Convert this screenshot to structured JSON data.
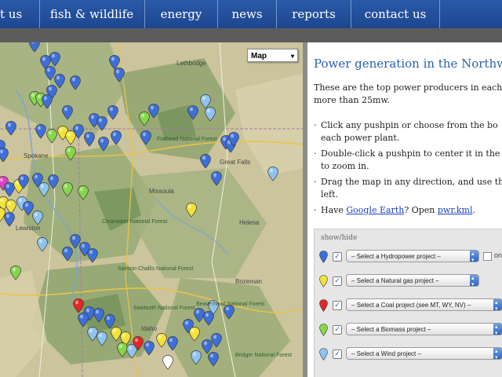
{
  "nav": {
    "items": [
      {
        "label": "t us"
      },
      {
        "label": "fish & wildlife"
      },
      {
        "label": "energy"
      },
      {
        "label": "news"
      },
      {
        "label": "reports"
      },
      {
        "label": "contact us"
      }
    ]
  },
  "map": {
    "type_control": "Map",
    "places": [
      "Lethbridge",
      "Spokane",
      "Great Falls",
      "Missoula",
      "Lewiston",
      "Idaho",
      "Helena",
      "Bozeman"
    ],
    "forests": [
      "Flathead National Forest",
      "Clearwater National Forest",
      "Salmon-Challis National Forest",
      "Sawtooth National Forest",
      "Beaverhead National Forest",
      "Bridger National Forest"
    ],
    "pin_colors": {
      "hydro": "#3d6fd8",
      "light_blue": "#8ec4ee",
      "natural_gas": "#f2e23a",
      "coal": "#e02828",
      "biomass": "#86d64a",
      "pink": "#e040c0",
      "white": "#ffffff"
    }
  },
  "panel": {
    "title": "Power generation in the Northw",
    "intro_line1": "These are the top power producers in each",
    "intro_line2": "more than 25mw.",
    "bullets": [
      {
        "line1": "Click any pushpin or choose from the bo",
        "line2": "each power plant."
      },
      {
        "line1": "Double-click a pushpin to center it in the",
        "line2": "to zoom in."
      },
      {
        "line1": "Drag the map in any direction, and use th",
        "line2": "left."
      }
    ],
    "have_prefix": "Have",
    "google_earth": "Google Earth",
    "open_text": "? Open",
    "kml_link": "pwr.kml",
    "kml_suffix": "."
  },
  "controls": {
    "showhide": "show/hide",
    "rows": [
      {
        "pin_color": "#3d6fd8",
        "label": "– Select a Hydropower project –",
        "extra": "onl"
      },
      {
        "pin_color": "#f2e23a",
        "label": "– Select a Natural gas project –"
      },
      {
        "pin_color": "#e02828",
        "label": "– Select a Coal project (see MT, WY, NV) –"
      },
      {
        "pin_color": "#86d64a",
        "label": "– Select a Biomass project –"
      },
      {
        "pin_color": "#8ec4ee",
        "label": "– Select a Wind project –"
      }
    ]
  }
}
